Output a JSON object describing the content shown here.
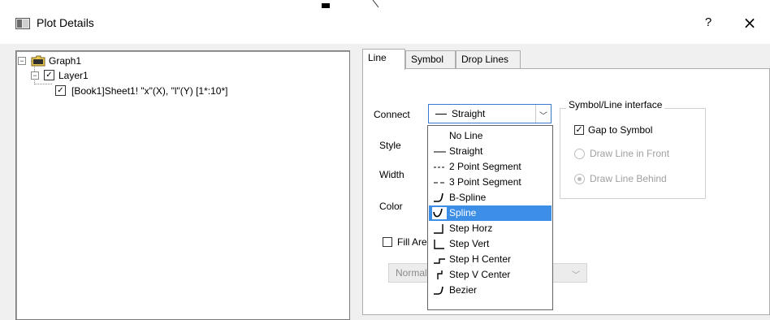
{
  "window": {
    "title": "Plot Details",
    "help_label": "?",
    "close_label": "×"
  },
  "tree": {
    "graph": "Graph1",
    "layer": "Layer1",
    "plot": "[Book1]Sheet1! \"x\"(X), \"l\"(Y) [1*:10*]"
  },
  "tabs": [
    {
      "label": "Line"
    },
    {
      "label": "Symbol"
    },
    {
      "label": "Drop Lines"
    }
  ],
  "line_tab": {
    "connect_label": "Connect",
    "connect_value": "Straight",
    "style_label": "Style",
    "width_label": "Width",
    "color_label": "Color",
    "fill_area_label": "Fill Are",
    "fill_mode_value": "Normal"
  },
  "symbol_line_interface": {
    "title": "Symbol/Line interface",
    "gap_to_symbol": "Gap to Symbol",
    "draw_in_front": "Draw Line in Front",
    "draw_behind": "Draw Line Behind"
  },
  "connect_options": [
    {
      "label": "No Line",
      "icon": "none"
    },
    {
      "label": "Straight",
      "icon": "straight-line-icon"
    },
    {
      "label": "2 Point Segment",
      "icon": "dashed-line-icon"
    },
    {
      "label": "3 Point Segment",
      "icon": "long-dashed-line-icon"
    },
    {
      "label": "B-Spline",
      "icon": "b-spline-icon"
    },
    {
      "label": "Spline",
      "icon": "spline-icon"
    },
    {
      "label": "Step Horz",
      "icon": "step-horz-icon"
    },
    {
      "label": "Step Vert",
      "icon": "step-vert-icon"
    },
    {
      "label": "Step H Center",
      "icon": "step-h-center-icon"
    },
    {
      "label": "Step V Center",
      "icon": "step-v-center-icon"
    },
    {
      "label": "Bezier",
      "icon": "bezier-icon"
    }
  ],
  "selected_option": "Spline",
  "colors": {
    "selection": "#3c8ee7",
    "focus_border": "#3a78c9"
  }
}
